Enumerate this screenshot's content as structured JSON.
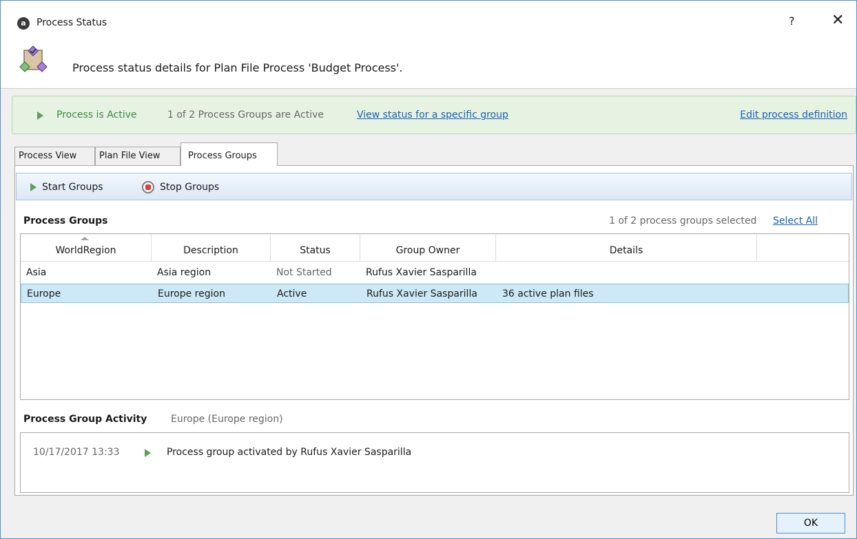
{
  "window": {
    "title": "Process Status",
    "help_label": "?",
    "close_label": "✕"
  },
  "header": {
    "text": "Process status details for Plan File Process 'Budget Process'."
  },
  "status_bar": {
    "state": "Process is Active",
    "summary": "1 of 2 Process Groups are Active",
    "view_link": "View status for a specific group",
    "edit_link": "Edit process definition"
  },
  "tabs": [
    {
      "label": "Process View"
    },
    {
      "label": "Plan File View"
    },
    {
      "label": "Process Groups"
    }
  ],
  "toolbar": {
    "start_label": "Start Groups",
    "stop_label": "Stop Groups"
  },
  "groups": {
    "title": "Process Groups",
    "selection_count": "1 of 2 process groups selected",
    "select_all": "Select All",
    "columns": [
      "WorldRegion",
      "Description",
      "Status",
      "Group Owner",
      "Details"
    ],
    "rows": [
      {
        "region": "Asia",
        "description": "Asia region",
        "status": "Not Started",
        "owner": "Rufus Xavier Sasparilla",
        "details": ""
      },
      {
        "region": "Europe",
        "description": "Europe region",
        "status": "Active",
        "owner": "Rufus Xavier Sasparilla",
        "details": "36 active plan files"
      }
    ]
  },
  "activity": {
    "title": "Process Group Activity",
    "subtitle": "Europe (Europe region)",
    "entries": [
      {
        "time": "10/17/2017 13:33",
        "text": "Process group activated by Rufus Xavier Sasparilla"
      }
    ]
  },
  "footer": {
    "ok_label": "OK"
  }
}
